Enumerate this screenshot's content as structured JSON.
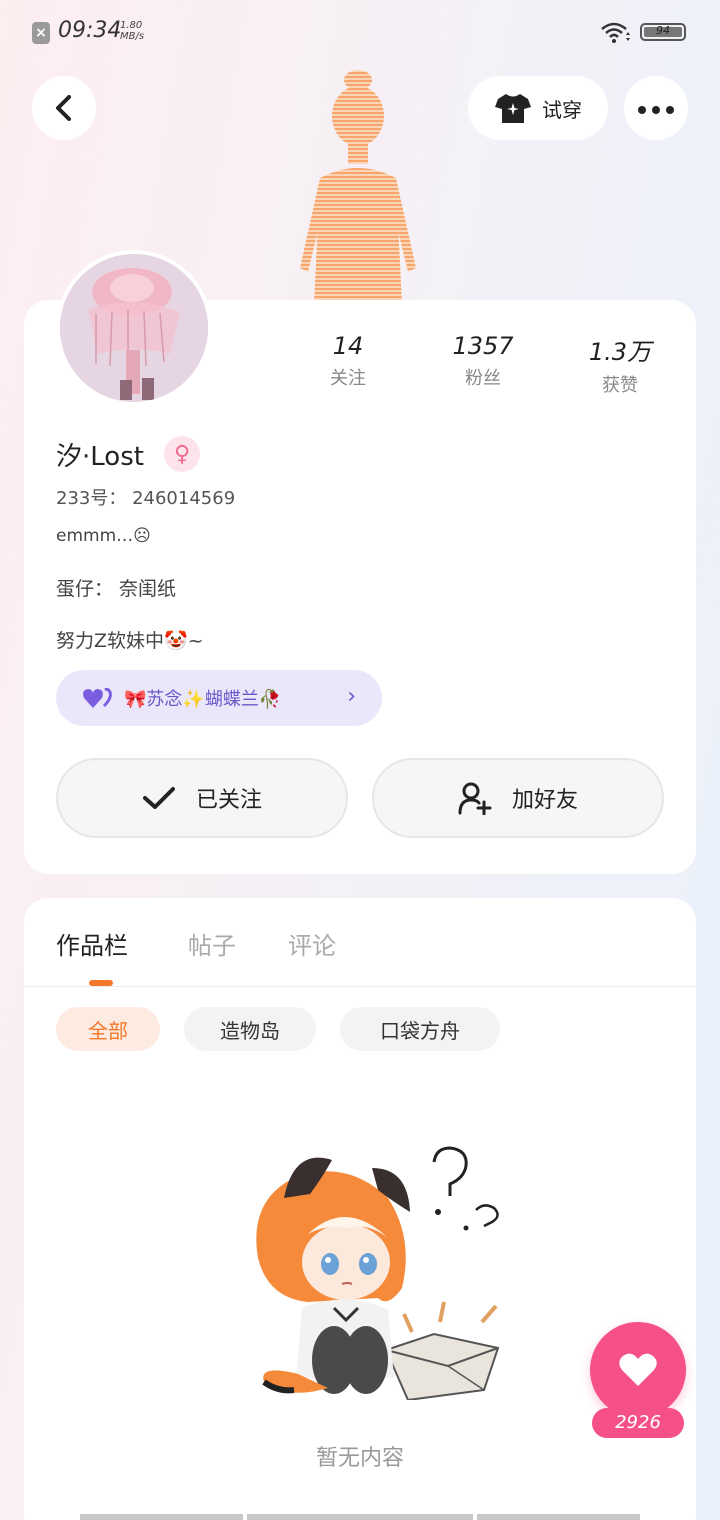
{
  "status_bar": {
    "time": "09:34",
    "speed_value": "1.80",
    "speed_unit": "MB/s",
    "battery": "94"
  },
  "top_nav": {
    "try_on_label": "试穿"
  },
  "profile": {
    "stats": [
      {
        "value": "14",
        "label": "关注"
      },
      {
        "value": "1357",
        "label": "粉丝"
      },
      {
        "value": "1.3万",
        "label": "获赞"
      }
    ],
    "username": "汐·Lost",
    "gender_symbol": "♀",
    "id_line": "233号： 246014569",
    "bio_line1": "emmm…☹",
    "bio_line2": "蛋仔： 奈闺纸",
    "bio_line3": "努力Z软妹中🤡~",
    "tag_text": "🎀苏念✨蝴蝶兰🥀",
    "follow_label": "已关注",
    "add_friend_label": "加好友"
  },
  "works": {
    "tabs": [
      "作品栏",
      "帖子",
      "评论"
    ],
    "filters": [
      "全部",
      "造物岛",
      "口袋方舟"
    ],
    "empty_text": "暂无内容"
  },
  "like": {
    "count": "2926"
  },
  "colors": {
    "accent_orange": "#f3772a",
    "like_pink": "#f6508a",
    "tag_purple": "#6a58c8"
  }
}
